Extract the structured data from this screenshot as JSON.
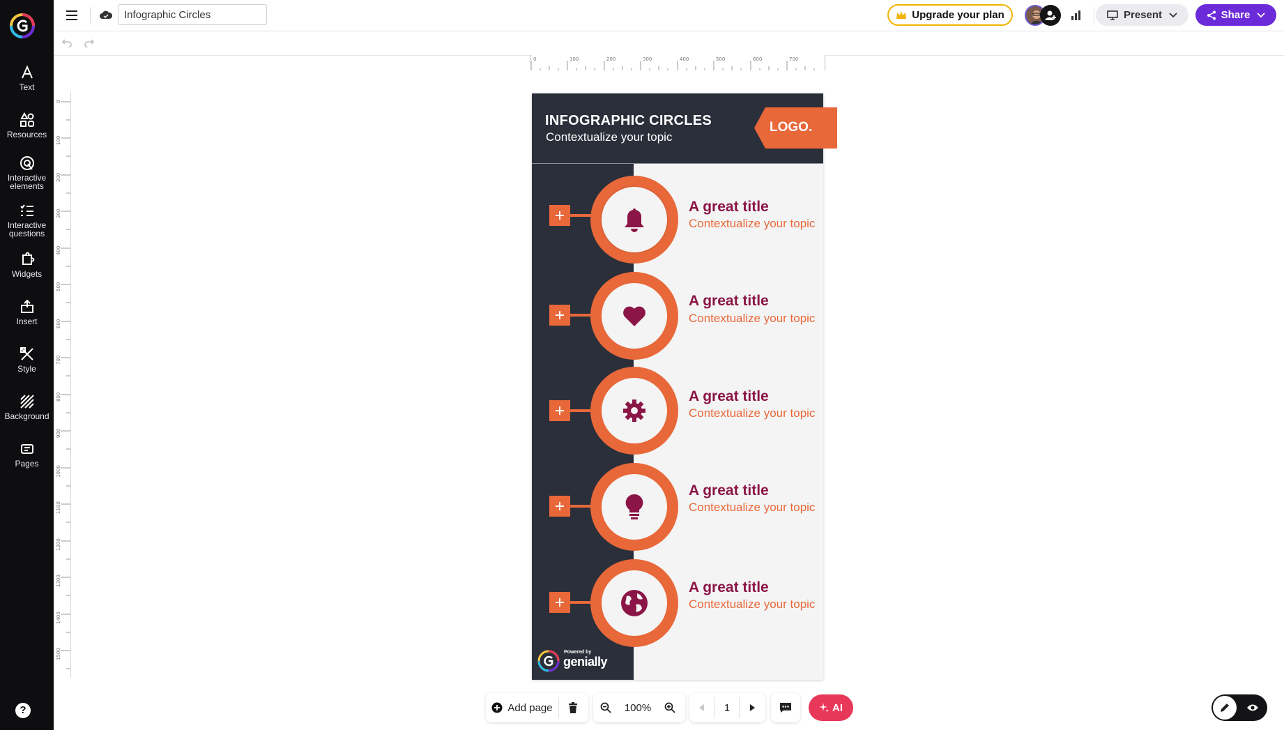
{
  "app": {
    "document_title": "Infographic Circles",
    "upgrade_label": "Upgrade your plan",
    "present_label": "Present",
    "share_label": "Share"
  },
  "sidebar": {
    "items": [
      {
        "label": "Text",
        "icon": "text-icon"
      },
      {
        "label": "Resources",
        "icon": "resources-icon"
      },
      {
        "label": "Interactive elements",
        "icon": "interactive-elements-icon"
      },
      {
        "label": "Interactive questions",
        "icon": "interactive-questions-icon"
      },
      {
        "label": "Widgets",
        "icon": "widgets-icon"
      },
      {
        "label": "Insert",
        "icon": "insert-icon"
      },
      {
        "label": "Style",
        "icon": "style-icon"
      },
      {
        "label": "Background",
        "icon": "background-icon"
      },
      {
        "label": "Pages",
        "icon": "pages-icon"
      }
    ],
    "help_label": "?"
  },
  "rulers": {
    "top_ticks": [
      "0",
      "100",
      "200",
      "300",
      "400",
      "500",
      "600",
      "700"
    ],
    "left_ticks": [
      "0",
      "100",
      "200",
      "300",
      "400",
      "500",
      "600",
      "700",
      "800",
      "900",
      "1000",
      "1100",
      "1200",
      "1300",
      "1400",
      "1500"
    ]
  },
  "slide": {
    "title": "INFOGRAPHIC CIRCLES",
    "subtitle": "Contextualize your topic",
    "logo": "LOGO.",
    "rows": [
      {
        "title": "A great title",
        "subtitle": "Contextualize your topic",
        "icon": "bell-icon"
      },
      {
        "title": "A great title",
        "subtitle": "Contextualize your topic",
        "icon": "heart-icon"
      },
      {
        "title": "A great title",
        "subtitle": "Contextualize your topic",
        "icon": "gear-icon"
      },
      {
        "title": "A great title",
        "subtitle": "Contextualize your topic",
        "icon": "lightbulb-icon"
      },
      {
        "title": "A great title",
        "subtitle": "Contextualize your topic",
        "icon": "globe-icon"
      }
    ],
    "watermark_small": "Powered by",
    "watermark_brand": "genially"
  },
  "bottom_bar": {
    "add_page_label": "Add page",
    "zoom": "100%",
    "page_number": "1",
    "ai_label": "AI"
  },
  "colors": {
    "accent_orange": "#e8683a",
    "dark_navy": "#2b2f3a",
    "title_magenta": "#8a1546",
    "brand_purple": "#6c2bd9",
    "ai_pink": "#e8385a",
    "upgrade_border": "#f0b400"
  }
}
